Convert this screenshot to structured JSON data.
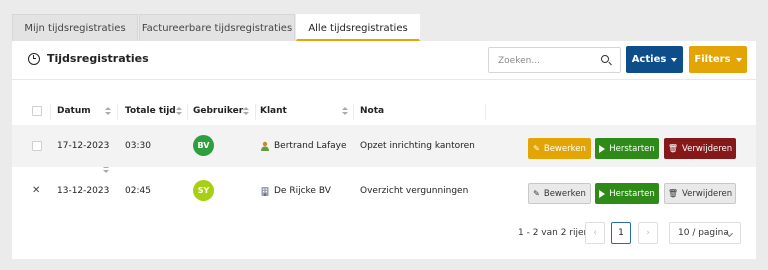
{
  "tabs": [
    {
      "label": "Mijn tijdsregistraties"
    },
    {
      "label": "Factureerbare tijdsregistraties"
    },
    {
      "label": "Alle tijdsregistraties"
    }
  ],
  "header": {
    "title": "Tijdsregistraties",
    "title_icon": "clock-icon",
    "search_placeholder": "Zoeken...",
    "acties_label": "Acties",
    "filters_label": "Filters"
  },
  "columns": [
    "Datum",
    "Totale tijd",
    "Gebruiker",
    "Klant",
    "Nota"
  ],
  "rows": [
    {
      "datum": "17-12-2023",
      "tijd": "03:30",
      "gebruiker": "BV",
      "avatar_color": "#2e9e3e",
      "klant": "Bertrand Lafaye",
      "klant_icon": "person-icon",
      "nota": "Opzet inrichting kantoren",
      "edit_label": "Bewerken",
      "restart_label": "Herstarten",
      "delete_label": "Verwijderen"
    },
    {
      "datum": "13-12-2023",
      "tijd": "02:45",
      "gebruiker": "SY",
      "avatar_color": "#a8d012",
      "klant": "De Rijcke BV",
      "klant_icon": "building-icon",
      "nota": "Overzicht vergunningen",
      "edit_label": "Bewerken",
      "restart_label": "Herstarten",
      "delete_label": "Verwijderen"
    }
  ],
  "pagination": {
    "info": "1 - 2 van 2 rijen",
    "current_page": "1",
    "per_page": "10 / pagina"
  },
  "colors": {
    "acties": "#0d4e8a",
    "filters": "#e3a405",
    "edit_active": "#e3a405",
    "restart": "#2e8b18",
    "delete_active": "#851818"
  }
}
